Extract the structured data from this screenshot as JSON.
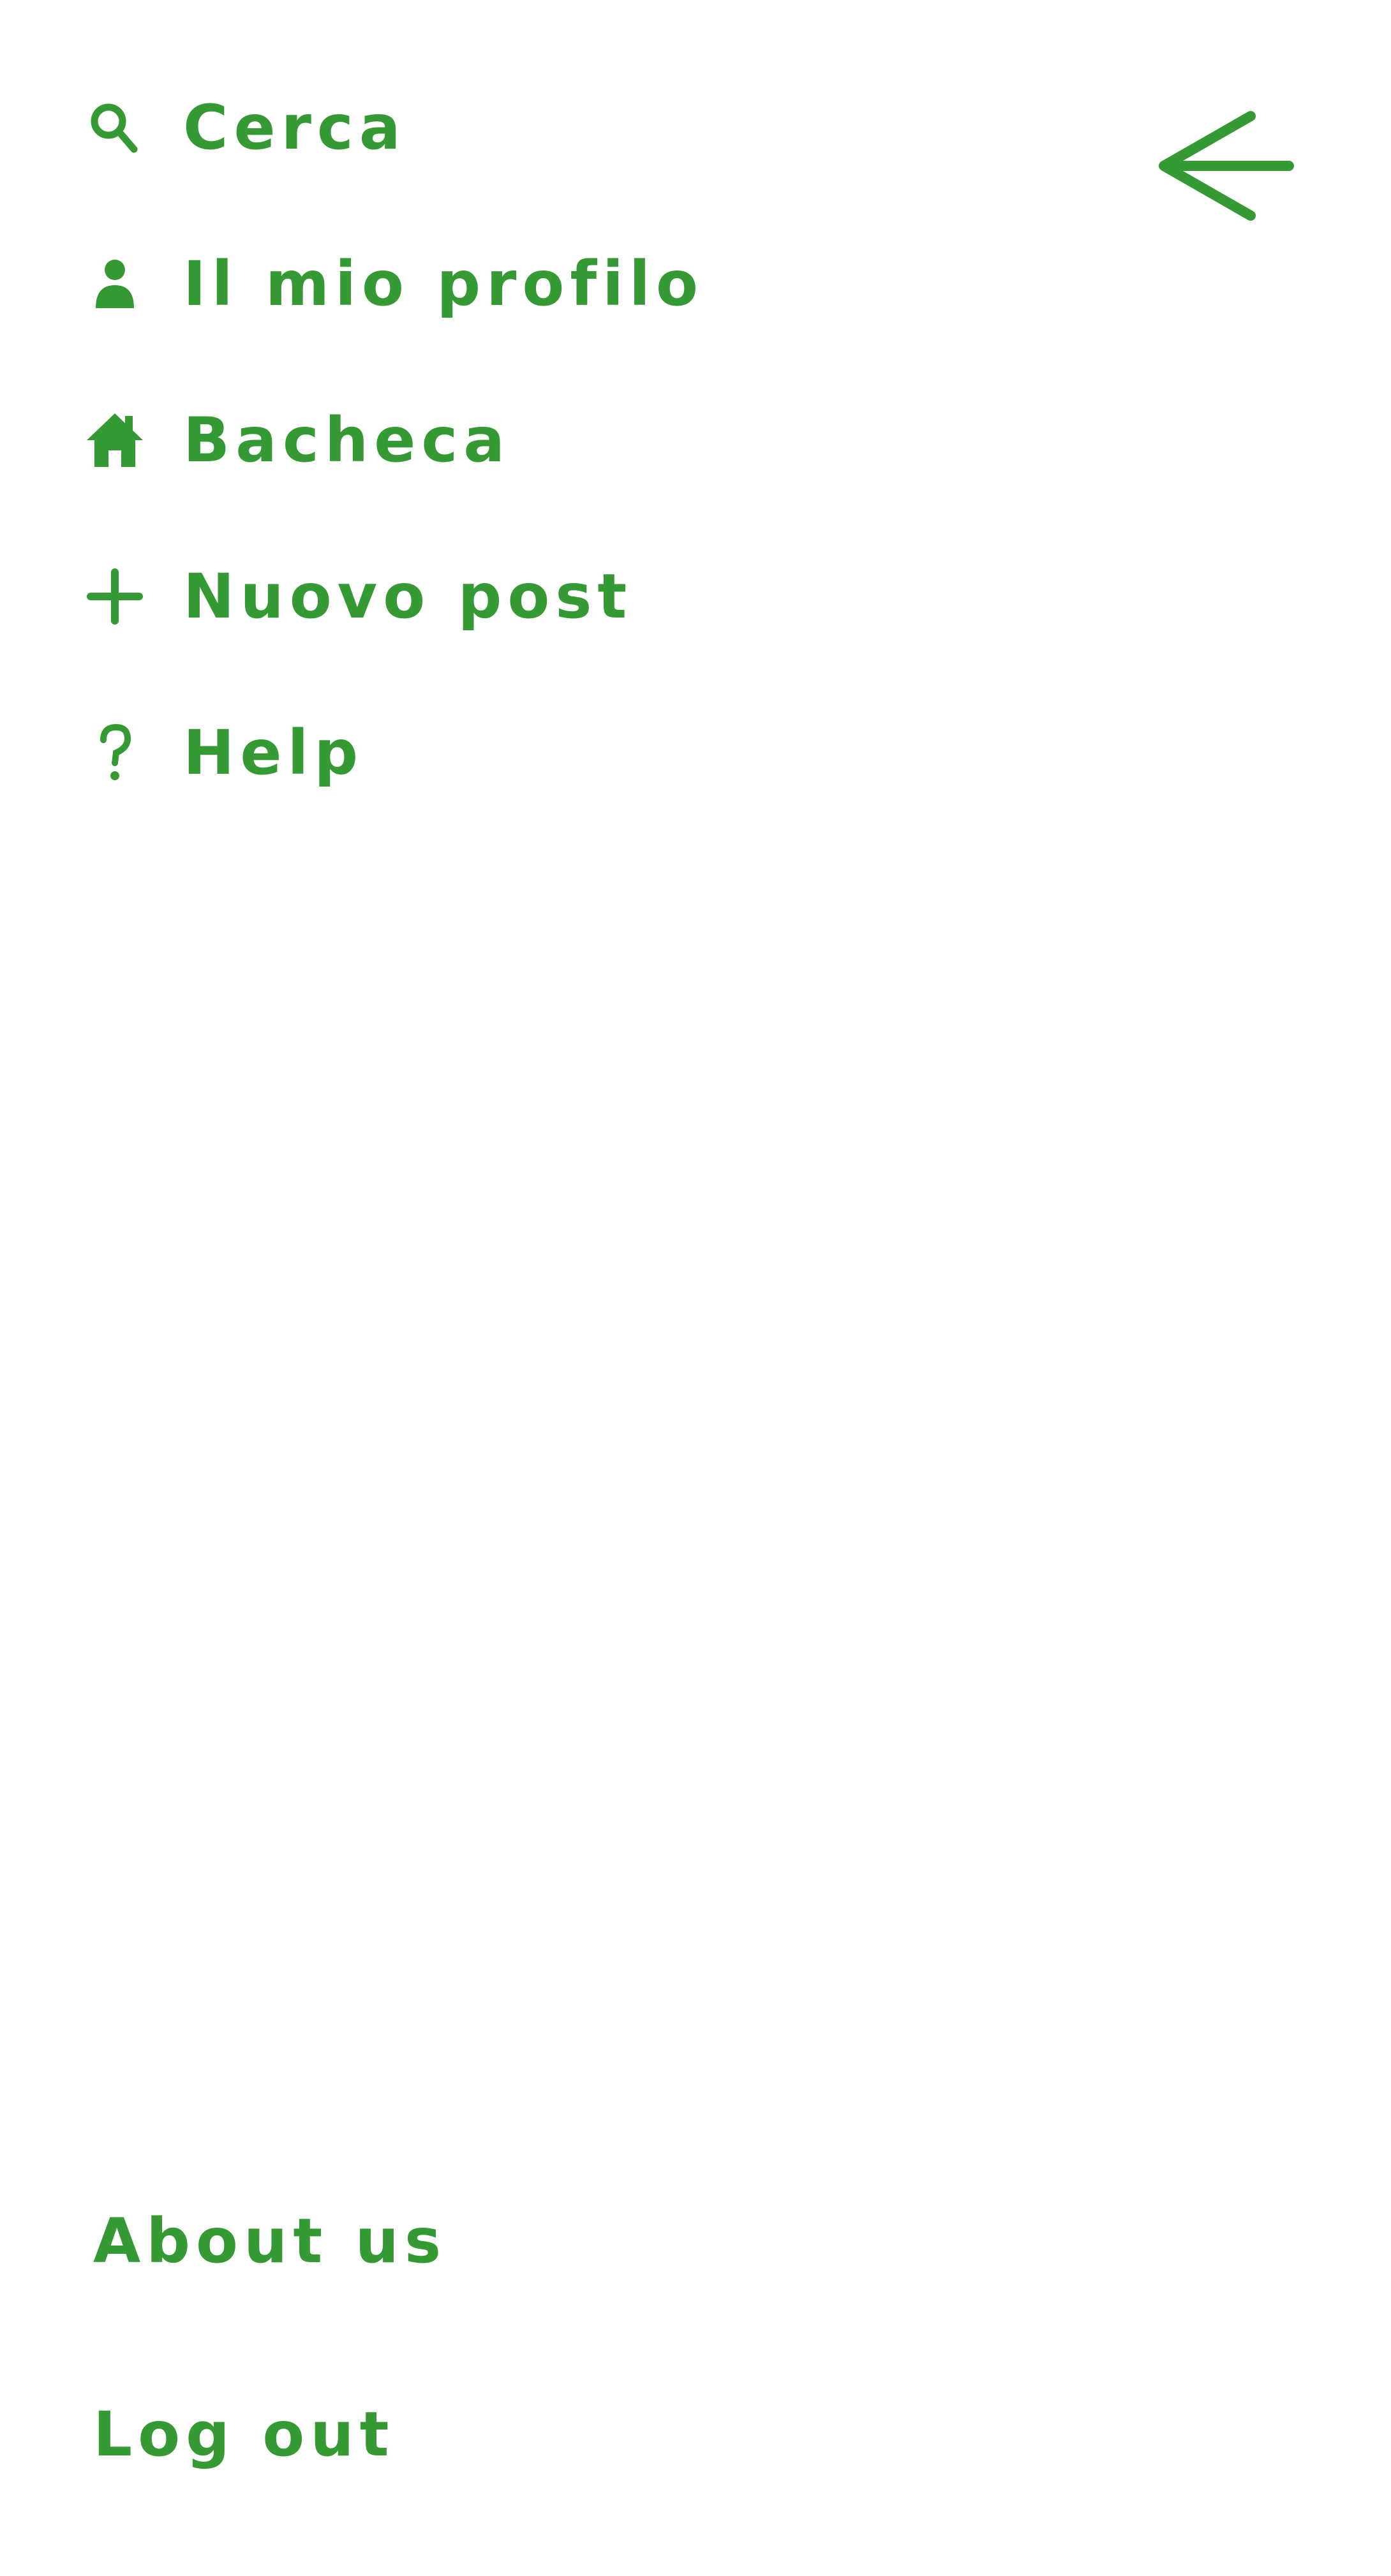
{
  "theme": {
    "accent": "#359934",
    "background": "#ffffff"
  },
  "header": {
    "back_icon": "arrow-left-icon"
  },
  "menu": {
    "items": [
      {
        "label": "Cerca",
        "icon": "search-icon"
      },
      {
        "label": "Il mio profilo",
        "icon": "user-icon"
      },
      {
        "label": "Bacheca",
        "icon": "home-icon"
      },
      {
        "label": "Nuovo post",
        "icon": "plus-icon"
      },
      {
        "label": "Help",
        "icon": "question-icon"
      }
    ]
  },
  "footer": {
    "about_label": "About us",
    "logout_label": "Log out"
  }
}
